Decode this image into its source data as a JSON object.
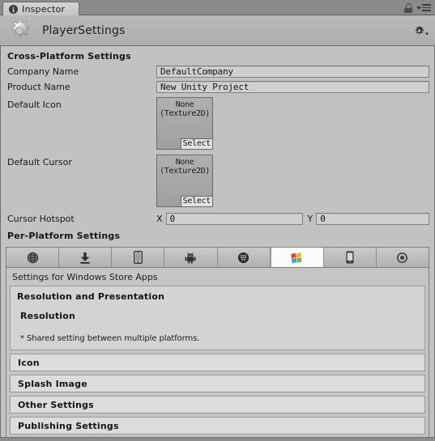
{
  "window": {
    "tab_label": "Inspector",
    "info_icon": "info-icon",
    "lock_icon": "lock-icon",
    "menu_icon": "menu-icon"
  },
  "object_header": {
    "icon": "cog-icon",
    "title": "PlayerSettings",
    "settings_icon": "gear-dropdown-icon"
  },
  "cross_platform": {
    "heading": "Cross-Platform Settings",
    "company_name": {
      "label": "Company Name",
      "value": "DefaultCompany"
    },
    "product_name": {
      "label": "Product Name",
      "value": "New Unity Project"
    },
    "default_icon": {
      "label": "Default Icon",
      "value": "None",
      "type": "(Texture2D)",
      "select_label": "Select"
    },
    "default_cursor": {
      "label": "Default Cursor",
      "value": "None",
      "type": "(Texture2D)",
      "select_label": "Select"
    },
    "cursor_hotspot": {
      "label": "Cursor Hotspot",
      "x_label": "X",
      "x_value": "0",
      "y_label": "Y",
      "y_value": "0"
    }
  },
  "per_platform": {
    "heading": "Per-Platform Settings",
    "tabs": [
      {
        "name": "web-player",
        "icon": "globe-icon",
        "active": false
      },
      {
        "name": "pc-mac-linux-standalone",
        "icon": "download-arrow-icon",
        "active": false
      },
      {
        "name": "ios",
        "icon": "mobile-phone-icon",
        "active": false
      },
      {
        "name": "android",
        "icon": "android-robot-icon",
        "active": false
      },
      {
        "name": "blackberry",
        "icon": "blackberry-icon",
        "active": false
      },
      {
        "name": "windows-store-apps",
        "icon": "windows-flag-icon",
        "active": true
      },
      {
        "name": "windows-phone",
        "icon": "windows-phone-icon",
        "active": false
      },
      {
        "name": "tizen",
        "icon": "tizen-circle-icon",
        "active": false
      }
    ],
    "panel_title": "Settings for Windows Store Apps",
    "resolution_group": {
      "title": "Resolution and Presentation",
      "subtitle": "Resolution",
      "note": "* Shared setting between multiple platforms."
    },
    "collapsed_sections": [
      {
        "label": "Icon"
      },
      {
        "label": "Splash Image"
      },
      {
        "label": "Other Settings"
      },
      {
        "label": "Publishing Settings"
      }
    ]
  },
  "colors": {
    "window_background": "#c2c2c2",
    "frame": "#8c8c8c",
    "border": "#6f6f6f",
    "field_background": "#cfcfcf",
    "panel_background": "#c5c5c5",
    "group_background": "#d3d3d3",
    "collapsed_background": "#dcdcdc",
    "active_tab": "#fbfbfb",
    "text": "#1a1a1a"
  }
}
